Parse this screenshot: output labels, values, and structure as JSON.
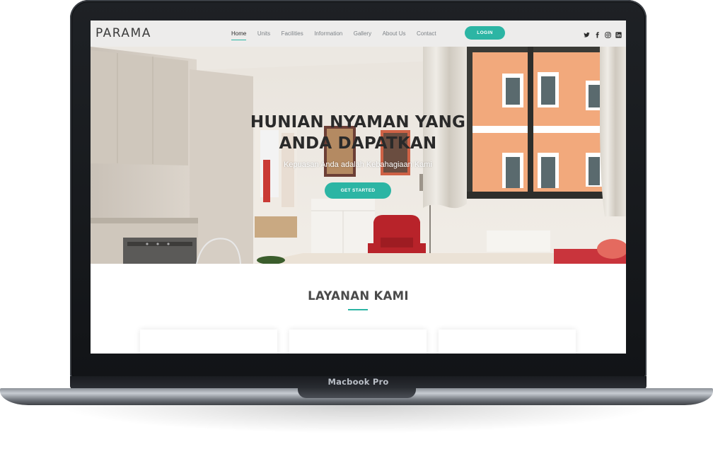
{
  "device": {
    "label": "Macbook Pro"
  },
  "site": {
    "logo": "PARAMA",
    "nav": {
      "items": [
        {
          "label": "Home",
          "active": true
        },
        {
          "label": "Units",
          "active": false
        },
        {
          "label": "Facilities",
          "active": false
        },
        {
          "label": "Information",
          "active": false
        },
        {
          "label": "Gallery",
          "active": false
        },
        {
          "label": "About Us",
          "active": false
        },
        {
          "label": "Contact",
          "active": false
        }
      ],
      "login_label": "LOGIN",
      "social_icons": [
        "twitter-icon",
        "facebook-icon",
        "instagram-icon",
        "linkedin-icon"
      ]
    },
    "hero": {
      "title_line1": "HUNIAN NYAMAN YANG",
      "title_line2": "ANDA DAPATKAN",
      "subtitle": "Kepuasan Anda adalah Kebahagiaan Kami",
      "cta_label": "GET STARTED"
    },
    "services": {
      "title": "LAYANAN KAMI"
    },
    "colors": {
      "accent": "#2cb5a4",
      "navbar_bg": "#edeceb",
      "heading": "#4a4a4a"
    }
  }
}
